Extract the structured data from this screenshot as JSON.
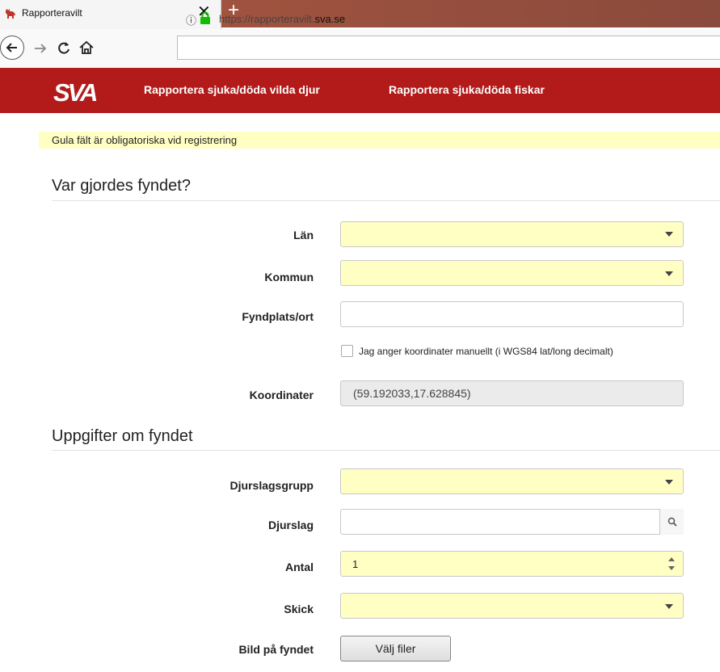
{
  "browser": {
    "tab_title": "Rapporteravilt",
    "tab_close": "✕",
    "new_tab": "+",
    "url_prefix": "https://rapporteravilt.",
    "url_domain": "sva.se",
    "info_glyph": "ⓘ"
  },
  "header": {
    "logo_text": "SVA",
    "nav": [
      "Rapportera sjuka/döda vilda djur",
      "Rapportera sjuka/döda fiskar"
    ],
    "brand_color": "#b31b1b"
  },
  "notice": "Gula fält är obligatoriska vid registrering",
  "section_location": {
    "title": "Var gjordes fyndet?",
    "lan_label": "Län",
    "kommun_label": "Kommun",
    "fyndplats_label": "Fyndplats/ort",
    "manual_coords_label": "Jag anger koordinater manuellt (i WGS84 lat/long decimalt)",
    "koordinater_label": "Koordinater",
    "koordinater_value": "(59.192033,17.628845)"
  },
  "section_details": {
    "title": "Uppgifter om fyndet",
    "djurslagsgrupp_label": "Djurslagsgrupp",
    "djurslag_label": "Djurslag",
    "antal_label": "Antal",
    "antal_value": "1",
    "skick_label": "Skick",
    "bild_label": "Bild på fyndet",
    "file_button_label": "Välj filer"
  },
  "colors": {
    "required_field": "#ffffc4",
    "disabled_field": "#ebebeb"
  }
}
